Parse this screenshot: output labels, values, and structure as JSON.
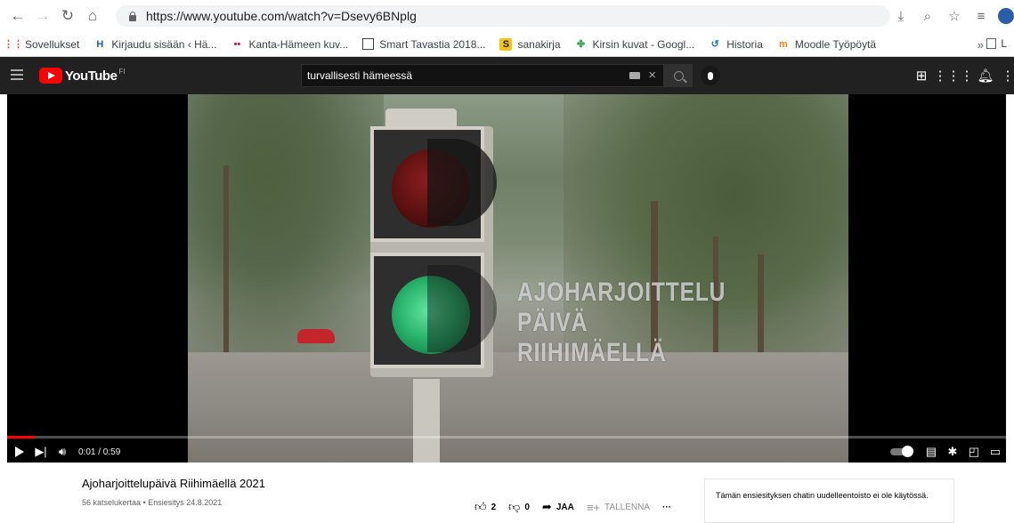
{
  "browser": {
    "url": "https://www.youtube.com/watch?v=Dsevy6BNplg",
    "bookmarks": [
      {
        "label": "Sovellukset",
        "icon": "apps-grid-icon"
      },
      {
        "label": "Kirjaudu sisään ‹ Hä...",
        "icon": "h-logo-icon"
      },
      {
        "label": "Kanta-Hämeen kuv...",
        "icon": "dots-icon"
      },
      {
        "label": "Smart Tavastia 2018...",
        "icon": "book-icon"
      },
      {
        "label": "sanakirja",
        "icon": "s-logo-icon"
      },
      {
        "label": "Kirsin kuvat - Googl...",
        "icon": "pinwheel-icon"
      },
      {
        "label": "Historia",
        "icon": "history-icon"
      },
      {
        "label": "Moodle Työpöytä",
        "icon": "moodle-icon"
      }
    ],
    "bookmarks_more": "»",
    "bookmarks_list_label": "L"
  },
  "youtube": {
    "logo_text": "YouTube",
    "region": "FI",
    "search_value": "turvallisesti hämeessä"
  },
  "player": {
    "overlay_line1": "AJOHARJOITTELU PÄIVÄ",
    "overlay_line2": "RIIHIMÄELLÄ",
    "time": "0:01 / 0:59",
    "progress_fraction": 0.028
  },
  "video": {
    "title": "Ajoharjoittelupäivä Riihimäellä 2021",
    "meta": "56 katselukertaa • Ensiesitys 24.8.2021",
    "likes": "2",
    "dislikes": "0",
    "share_label": "JAA",
    "save_label": "TALLENNA",
    "more_label": "···"
  },
  "chat": {
    "notice": "Tämän ensiesityksen chatin uudelleentoisto ei ole käytössä."
  },
  "colors": {
    "yt_header": "#212121",
    "yt_red": "#ff0000",
    "player_bg": "#000000"
  }
}
